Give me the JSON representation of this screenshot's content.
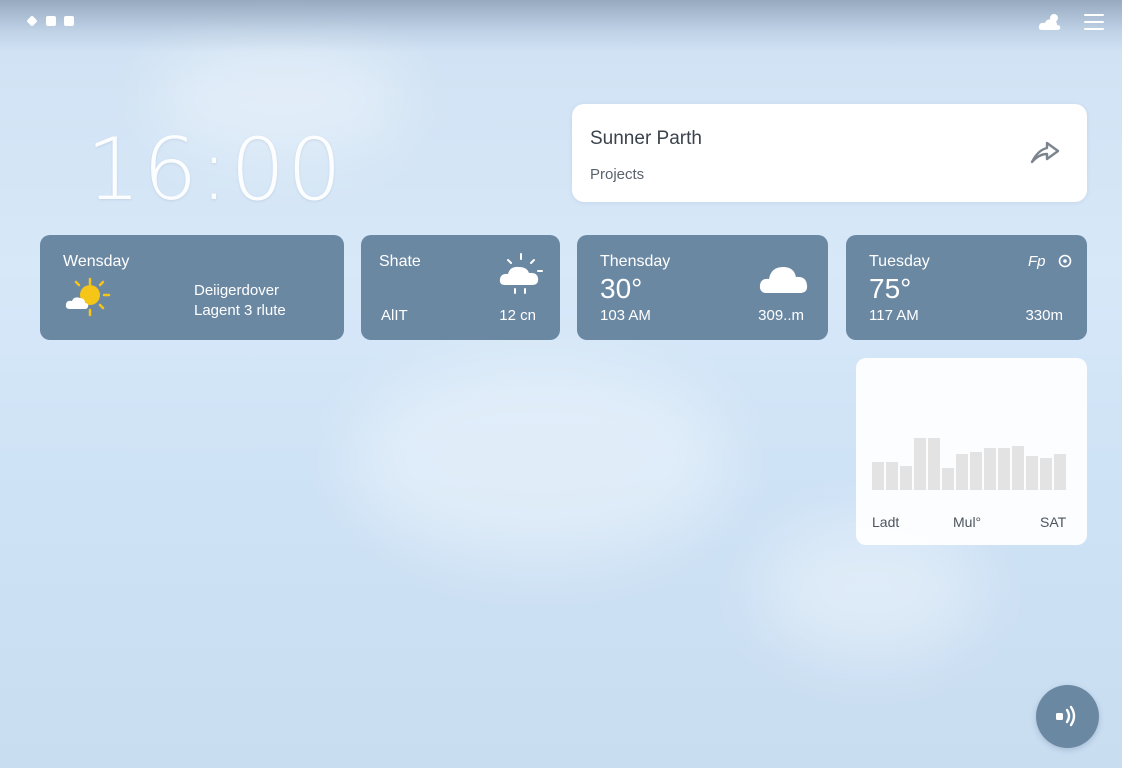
{
  "colors": {
    "card": "#6b88a3",
    "accent_sun": "#f5c518",
    "bar": "#e3e3e3"
  },
  "topbar": {
    "icons": [
      "back-icon",
      "window-icon",
      "window-icon",
      "weather-cloud-icon",
      "menu-icon"
    ]
  },
  "clock": {
    "time": "16:00"
  },
  "profile": {
    "name": "Sunner Parth",
    "subtitle": "Projects",
    "icon": "share-arrow-icon"
  },
  "forecast": [
    {
      "day": "Wensday",
      "icon": "sun-cloud-icon",
      "line1": "Deiigerdover",
      "line2": "Lagent 3 rlute"
    },
    {
      "day": "Shate",
      "icon": "sun-cloud-icon",
      "left": "AlIT",
      "right": "12 cn"
    },
    {
      "day": "Thensday",
      "temp": "30°",
      "icon": "cloud-icon",
      "left": "103 AM",
      "right": "309..m"
    },
    {
      "day": "Tuesday",
      "temp": "75°",
      "icon": "info-icon",
      "badge": "Fp",
      "left": "117 AM",
      "right": "330m"
    }
  ],
  "chart_data": {
    "type": "bar",
    "values": [
      28,
      28,
      24,
      52,
      52,
      22,
      36,
      38,
      42,
      42,
      44,
      34,
      32,
      36
    ],
    "ylim": [
      0,
      60
    ],
    "tick_labels": [
      "Ladt",
      "Mul°",
      "SAT"
    ]
  },
  "fab": {
    "icon": "sound-icon"
  }
}
